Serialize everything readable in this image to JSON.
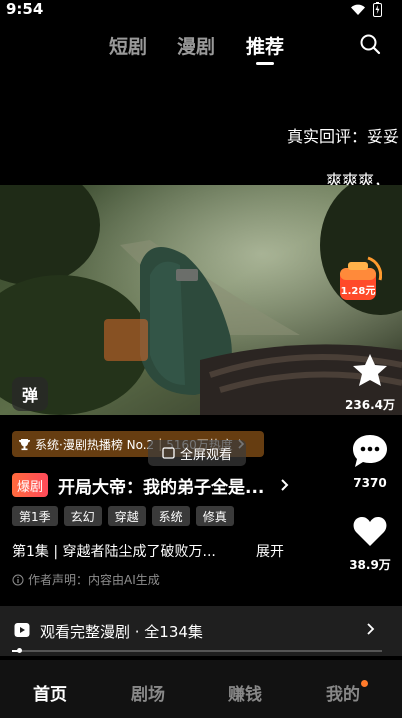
{
  "status_bar": {
    "time": "9:54",
    "icons": [
      "wifi-icon",
      "battery-charging-icon"
    ]
  },
  "top_nav": {
    "tabs": [
      {
        "label": "短剧",
        "active": false
      },
      {
        "label": "漫剧",
        "active": false
      },
      {
        "label": "推荐",
        "active": true
      }
    ],
    "search_icon": "search-icon"
  },
  "danmaku": [
    "真实回评：妥妥",
    "爽爽爽，"
  ],
  "video": {
    "danmaku_toggle_label": "弹",
    "fullscreen_label": "全屏观看"
  },
  "reward": {
    "amount": "1.28元"
  },
  "side_actions": [
    {
      "icon": "like-icon",
      "count": "236.4万"
    },
    {
      "icon": "comment-icon",
      "count": "7370"
    },
    {
      "icon": "heart-icon",
      "count": "38.9万"
    }
  ],
  "rank_banner": {
    "label": "系统·漫剧热播榜 No.2",
    "heat": "5160万热度"
  },
  "series": {
    "hot_badge": "爆剧",
    "title": "开局大帝：我的弟子全是...",
    "tags": [
      "第1季",
      "玄幻",
      "穿越",
      "系统",
      "修真"
    ],
    "episode_desc": "第1集 | 穿越者陆尘成了破败万...",
    "expand_label": "展开",
    "ai_note": "作者声明：内容由AI生成"
  },
  "full_bar": {
    "label": "观看完整漫剧 · 全134集",
    "progress": 0.02
  },
  "bottom_nav": [
    {
      "label": "首页",
      "active": true
    },
    {
      "label": "剧场",
      "active": false
    },
    {
      "label": "赚钱",
      "active": false
    },
    {
      "label": "我的",
      "active": false,
      "badge": true
    }
  ],
  "colors": {
    "accent_orange": "#ff6a3d",
    "rank_banner": "#7a4814",
    "notify_dot": "#ff7a2a"
  }
}
